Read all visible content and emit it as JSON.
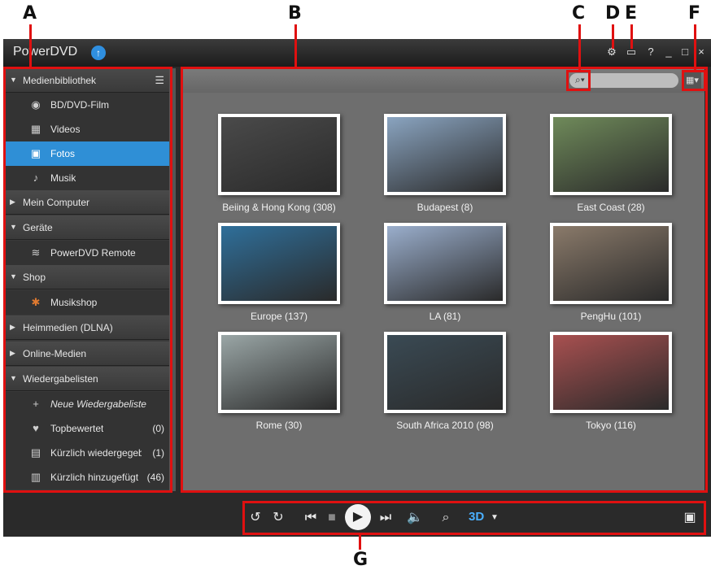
{
  "callouts": [
    "A",
    "B",
    "C",
    "D",
    "E",
    "F",
    "G"
  ],
  "window": {
    "title": "PowerDVD",
    "help": "?",
    "min": "_",
    "max": "□",
    "close": "×"
  },
  "sidebar": {
    "sections": {
      "medienbibliothek": "Medienbibliothek",
      "mein_computer": "Mein Computer",
      "geraete": "Geräte",
      "shop": "Shop",
      "heimmedien": "Heimmedien (DLNA)",
      "online": "Online-Medien",
      "wiedergabelisten": "Wiedergabelisten"
    },
    "items": {
      "bd": "BD/DVD-Film",
      "videos": "Videos",
      "fotos": "Fotos",
      "musik": "Musik",
      "remote": "PowerDVD Remote",
      "musikshop": "Musikshop",
      "neue": "Neue Wiedergabeliste",
      "top": "Topbewertet",
      "top_count": "(0)",
      "kuerzlich_wg": "Kürzlich wiedergegeb",
      "kuerzlich_wg_count": "(1)",
      "kuerzlich_hz": "Kürzlich hinzugefügt",
      "kuerzlich_hz_count": "(46)"
    }
  },
  "albums": [
    {
      "caption": "Beiing & Hong Kong (308)",
      "color": "#4a4a4a"
    },
    {
      "caption": "Budapest (8)",
      "color": "#8aa4c0"
    },
    {
      "caption": "East Coast (28)",
      "color": "#6f8a5a"
    },
    {
      "caption": "Europe (137)",
      "color": "#2f6f9a"
    },
    {
      "caption": "LA (81)",
      "color": "#9aaecc"
    },
    {
      "caption": "PengHu (101)",
      "color": "#8a7a6a"
    },
    {
      "caption": "Rome (30)",
      "color": "#9aa6a6"
    },
    {
      "caption": "South Africa 2010 (98)",
      "color": "#3a4a54"
    },
    {
      "caption": "Tokyo (116)",
      "color": "#a85050"
    }
  ],
  "controls": {
    "three_d": "3D"
  }
}
